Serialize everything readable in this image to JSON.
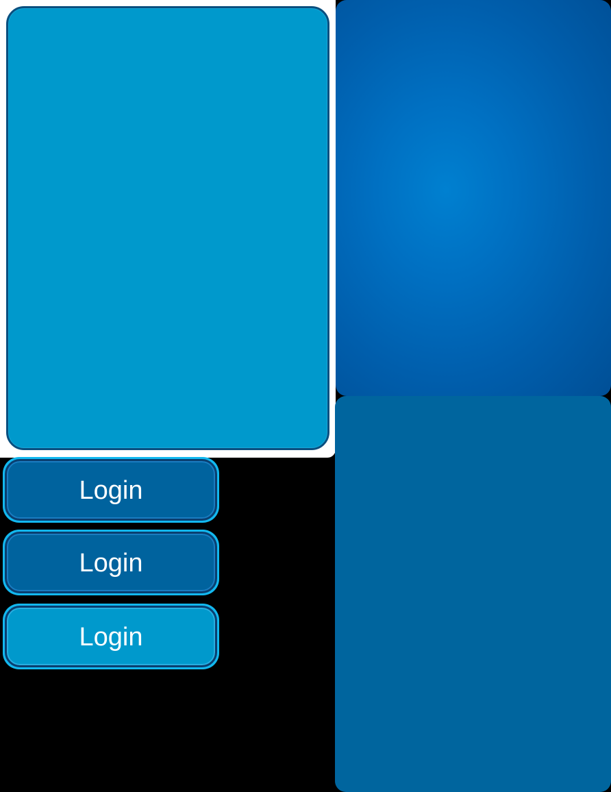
{
  "colors": {
    "background": "#000000",
    "panel_light": "#0099cc",
    "panel_border": "#0a4f7f",
    "panel_radial_center": "#0080d0",
    "panel_radial_edge": "#004f96",
    "panel_flat": "#00659e",
    "button_dark": "#00639e",
    "button_light": "#0099cc",
    "button_ring": "#12b8ef",
    "label_text": "#ffffff"
  },
  "buttons": [
    {
      "label": "Login",
      "state": "normal"
    },
    {
      "label": "Login",
      "state": "hover"
    },
    {
      "label": "Login",
      "state": "pressed"
    }
  ]
}
